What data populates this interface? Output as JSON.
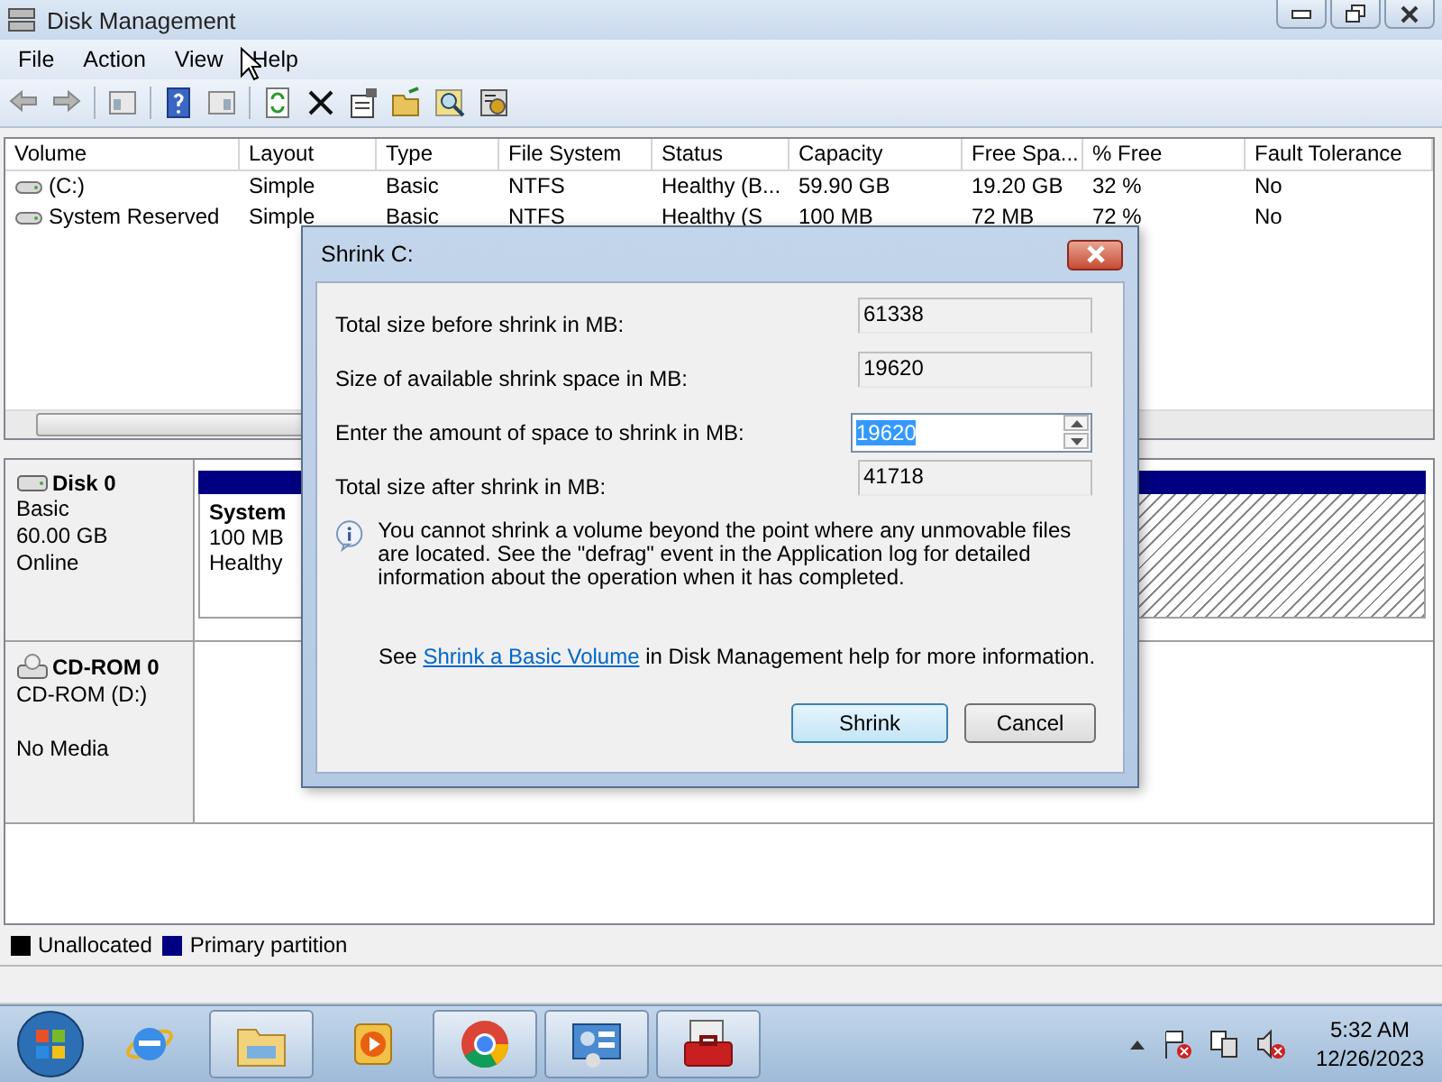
{
  "window": {
    "title": "Disk Management"
  },
  "menu": [
    "File",
    "Action",
    "View",
    "Help"
  ],
  "volume_table": {
    "columns": [
      "Volume",
      "Layout",
      "Type",
      "File System",
      "Status",
      "Capacity",
      "Free Spa...",
      "% Free",
      "Fault Tolerance"
    ],
    "rows": [
      [
        "(C:)",
        "Simple",
        "Basic",
        "NTFS",
        "Healthy (B...",
        "59.90 GB",
        "19.20 GB",
        "32 %",
        "No"
      ],
      [
        "System Reserved",
        "Simple",
        "Basic",
        "NTFS",
        "Healthy (S",
        "100 MB",
        "72 MB",
        "72 %",
        "No"
      ]
    ]
  },
  "disks": [
    {
      "kind": "disk",
      "name": "Disk 0",
      "details": [
        "Basic",
        "60.00 GB",
        "Online"
      ],
      "partitions": [
        {
          "name": "System",
          "lines": [
            "100 MB",
            "Healthy"
          ],
          "selected": false
        },
        {
          "selected": true
        }
      ]
    },
    {
      "kind": "cdrom",
      "name": "CD-ROM 0",
      "details": [
        "CD-ROM (D:)",
        "No Media"
      ]
    }
  ],
  "legend": [
    {
      "label": "Unallocated",
      "color": "#000000"
    },
    {
      "label": "Primary partition",
      "color": "#000080"
    }
  ],
  "dialog": {
    "title": "Shrink C:",
    "fields": [
      {
        "kind": "readonly",
        "label": "Total size before shrink in MB:",
        "value": "61338"
      },
      {
        "kind": "readonly",
        "label": "Size of available shrink space in MB:",
        "value": "19620"
      },
      {
        "kind": "spinner",
        "label": "Enter the amount of space to shrink in MB:",
        "value": "19620",
        "highlighted": true
      },
      {
        "kind": "readonly",
        "label": "Total size after shrink in MB:",
        "value": "41718"
      }
    ],
    "info": "You cannot shrink a volume beyond the point where any unmovable files are located. See the \"defrag\" event in the Application log for detailed information about the operation when it has completed.",
    "help": {
      "before": "See ",
      "link": "Shrink a Basic Volume",
      "after": " in Disk Management help for more information."
    },
    "buttons": [
      {
        "label": "Shrink",
        "default": true
      },
      {
        "label": "Cancel",
        "default": false
      }
    ]
  },
  "taskbar": {
    "apps": [
      {
        "kind": "ie",
        "running": false
      },
      {
        "kind": "explorer",
        "running": true
      },
      {
        "kind": "media",
        "running": false
      },
      {
        "kind": "chrome",
        "running": true
      },
      {
        "kind": "panel",
        "running": true
      },
      {
        "kind": "toolbox",
        "running": true
      }
    ],
    "time": "5:32 AM",
    "date": "12/26/2023"
  }
}
